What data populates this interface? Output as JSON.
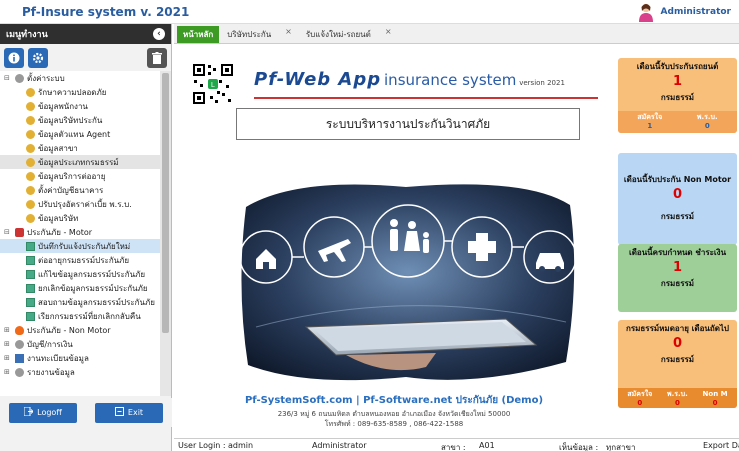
{
  "app": {
    "title": "Pf-Insure system v. 2021"
  },
  "user": {
    "name": "Administrator"
  },
  "sidebar": {
    "header": "เมนูทำงาน",
    "search_placeholder": "ค้นหาเมนูทำงาน",
    "items": [
      {
        "label": "ตั้งค่าระบบ",
        "level": 0,
        "icon": "gear-icon"
      },
      {
        "label": "รักษาความปลอดภัย",
        "level": 1,
        "icon": "gear-icon"
      },
      {
        "label": "ข้อมูลพนักงาน",
        "level": 1,
        "icon": "gear-icon"
      },
      {
        "label": "ข้อมูลบริษัทประกัน",
        "level": 1,
        "icon": "gear-icon"
      },
      {
        "label": "ข้อมูลตัวแทน Agent",
        "level": 1,
        "icon": "gear-icon"
      },
      {
        "label": "ข้อมูลสาขา",
        "level": 1,
        "icon": "gear-icon"
      },
      {
        "label": "ข้อมูลประเภทกรมธรรม์",
        "level": 1,
        "icon": "gear-icon"
      },
      {
        "label": "ข้อมูลบริการต่ออายุ",
        "level": 1,
        "icon": "gear-icon"
      },
      {
        "label": "ตั้งค่าบัญชีธนาคาร",
        "level": 1,
        "icon": "gear-icon"
      },
      {
        "label": "ปรับปรุงอัตราค่าเบี้ย พ.ร.บ.",
        "level": 1,
        "icon": "gear-icon"
      },
      {
        "label": "ข้อมูลบริษัท",
        "level": 1,
        "icon": "gear-icon"
      },
      {
        "label": "ประกันภัย - Motor",
        "level": 0,
        "icon": "car-icon"
      },
      {
        "label": "บันทึกรับแจ้งประกันภัยใหม่",
        "level": 1,
        "icon": "doc-icon"
      },
      {
        "label": "ต่ออายุกรมธรรม์ประกันภัย",
        "level": 1,
        "icon": "doc-icon"
      },
      {
        "label": "แก้ไขข้อมูลกรมธรรม์ประกันภัย",
        "level": 1,
        "icon": "doc-icon"
      },
      {
        "label": "ยกเลิกข้อมูลกรมธรรม์ประกันภัย",
        "level": 1,
        "icon": "doc-icon"
      },
      {
        "label": "สอบถามข้อมูลกรมธรรม์ประกันภัย",
        "level": 1,
        "icon": "doc-icon"
      },
      {
        "label": "เรียกกรมธรรม์ที่ยกเลิกกลับคืน",
        "level": 1,
        "icon": "doc-icon"
      },
      {
        "label": "ประกันภัย - Non Motor",
        "level": 0,
        "icon": "fire-icon"
      },
      {
        "label": "บัญชี/การเงิน",
        "level": 0,
        "icon": "gear-icon"
      },
      {
        "label": "งานทะเบียนข้อมูล",
        "level": 0,
        "icon": "book-icon"
      },
      {
        "label": "รายงานข้อมูล",
        "level": 0,
        "icon": "gear-icon"
      }
    ],
    "logoff_label": "Logoff",
    "exit_label": "Exit"
  },
  "tabs": [
    {
      "label": "หน้าหลัก"
    },
    {
      "label": "บริษัทประกัน"
    },
    {
      "label": "รับแจ้งใหม่-รถยนต์"
    }
  ],
  "main": {
    "brand_main": "Pf-Web App",
    "brand_sub": "insurance system",
    "brand_version": "version 2021",
    "system_title": "ระบบบริหารงานประกันวินาศภัย",
    "brand_link": "Pf-SystemSoft.com | Pf-Software.net ประกันภัย (Demo)",
    "address": "236/3 หมู่ 6 ถนนมหิดล ตำบลหนองหอย อำเภอเมือง จังหวัดเชียงใหม่ 50000",
    "phone": "โทรศัพท์ : 089-635-8589 , 086-422-1588"
  },
  "cards": [
    {
      "title": "เดือนนี้รับประกันรถยนต์",
      "value": "1",
      "unit": "กรมธรรม์",
      "sub_labels": [
        "สมัครใจ",
        "พ.ร.บ."
      ],
      "sub_values": [
        "1",
        "0"
      ],
      "color": "#f8bf7b"
    },
    {
      "title": "เดือนนี้รับประกัน Non Motor",
      "value": "0",
      "unit": "กรมธรรม์",
      "color": "#b9d7f4"
    },
    {
      "title": "เดือนนี้ครบกำหนด ชำระเงิน",
      "value": "1",
      "unit": "กรมธรรม์",
      "color": "#9ecf98"
    },
    {
      "title": "กรมธรรม์หมดอายุ เดือนถัดไป",
      "value": "0",
      "unit": "กรมธรรม์",
      "sub_labels": [
        "สมัครใจ",
        "พ.ร.บ.",
        "Non M"
      ],
      "sub_values": [
        "0",
        "0",
        "0"
      ],
      "color": "#f8bf7b"
    }
  ],
  "status": {
    "user_login_label": "User Login :",
    "user_login_value": "admin",
    "role": "Administrator",
    "branch_label": "สาขา :",
    "branch_value": "A01",
    "view_label": "เห็นข้อมูล :",
    "view_value": "ทุกสาขา",
    "export_label": "Export Da"
  }
}
